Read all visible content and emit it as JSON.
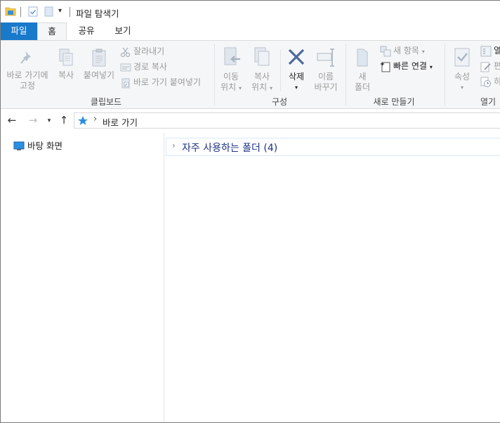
{
  "window": {
    "title": "파일 탐색기"
  },
  "tabs": [
    {
      "label": "파일"
    },
    {
      "label": "홈"
    },
    {
      "label": "공유"
    },
    {
      "label": "보기"
    }
  ],
  "ribbon": {
    "clipboard": {
      "group_label": "클립보드",
      "pin_line1": "바로 가기에",
      "pin_line2": "고정",
      "copy": "복사",
      "paste": "붙여넣기",
      "cut": "잘라내기",
      "copy_path": "경로 복사",
      "paste_shortcut": "바로 가기 붙여넣기"
    },
    "organize": {
      "group_label": "구성",
      "move_line1": "이동",
      "move_line2": "위치",
      "copyto_line1": "복사",
      "copyto_line2": "위치",
      "delete": "삭제",
      "rename_line1": "이름",
      "rename_line2": "바꾸기"
    },
    "new": {
      "group_label": "새로 만들기",
      "new_folder_line1": "새",
      "new_folder_line2": "폴더",
      "new_item": "새 항목",
      "easy_access": "빠른 연결"
    },
    "open": {
      "group_label": "열기",
      "properties": "속성",
      "open_small": "열",
      "edit_small": "편",
      "history_small": "히"
    }
  },
  "address": {
    "crumb": "바로 가기"
  },
  "navpane": {
    "items": [
      {
        "label": "바탕 화면",
        "icon": "desktop-icon"
      }
    ]
  },
  "content": {
    "groups": [
      {
        "label": "자주 사용하는 폴더 (4)"
      }
    ]
  },
  "colors": {
    "accent": "#1979ca",
    "ribbon_bg": "#f5f6f7",
    "group_text": "#1e3287"
  }
}
